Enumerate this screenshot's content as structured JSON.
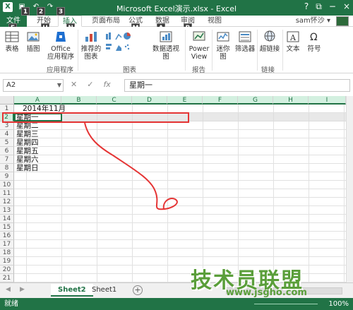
{
  "window": {
    "title": "Microsoft Excel演示.xlsx - Excel",
    "help": "?",
    "restore": "⧉",
    "minimize": "−",
    "close": "×"
  },
  "keytips": [
    "1",
    "2",
    "3",
    "F",
    "H",
    "N",
    "P",
    "M",
    "A",
    "R"
  ],
  "tabs": {
    "file": "文件",
    "home": "开始",
    "insert": "插入",
    "page_layout": "页面布局",
    "formulas": "公式",
    "data": "数据",
    "review": "审阅",
    "view": "视图"
  },
  "user": "sam怀沙 ▾",
  "ribbon": {
    "table": "表格",
    "illustrations": "插图",
    "office_apps_1": "Office",
    "office_apps_2": "应用程序",
    "recommended_charts_1": "推荐的",
    "recommended_charts_2": "图表",
    "pivot_chart": "数据透视图",
    "power_view_1": "Power",
    "power_view_2": "View",
    "sparklines": "迷你图",
    "slicer": "筛选器",
    "hyperlink": "超链接",
    "text": "文本",
    "symbols": "符号",
    "group_apps": "应用程序",
    "group_charts": "图表",
    "group_reports": "报告",
    "group_links": "链接"
  },
  "formula_bar": {
    "name_box": "A2",
    "cancel": "✕",
    "enter": "✓",
    "fx": "fx",
    "content": "星期一"
  },
  "columns": [
    "A",
    "B",
    "C",
    "D",
    "E",
    "F",
    "G",
    "H",
    "I"
  ],
  "rows": [
    "1",
    "2",
    "3",
    "4",
    "5",
    "6",
    "7",
    "8",
    "9",
    "10",
    "11",
    "12",
    "13",
    "14",
    "15",
    "16",
    "17",
    "18",
    "19",
    "20",
    "21"
  ],
  "cells": {
    "a1": "2014年11月",
    "a2": "星期一",
    "a3": "星期二",
    "a4": "星期三",
    "a5": "星期四",
    "a6": "星期五",
    "a7": "星期六",
    "a8": "星期日"
  },
  "sheets": {
    "active": "Sheet2",
    "other": "Sheet1",
    "add": "+"
  },
  "status": {
    "ready": "就绪",
    "zoom": "100%"
  },
  "watermark": {
    "text": "技术员联盟",
    "url": "www.jsgho.com"
  },
  "colors": {
    "excel_green": "#217346",
    "annotation_red": "#e53535"
  }
}
